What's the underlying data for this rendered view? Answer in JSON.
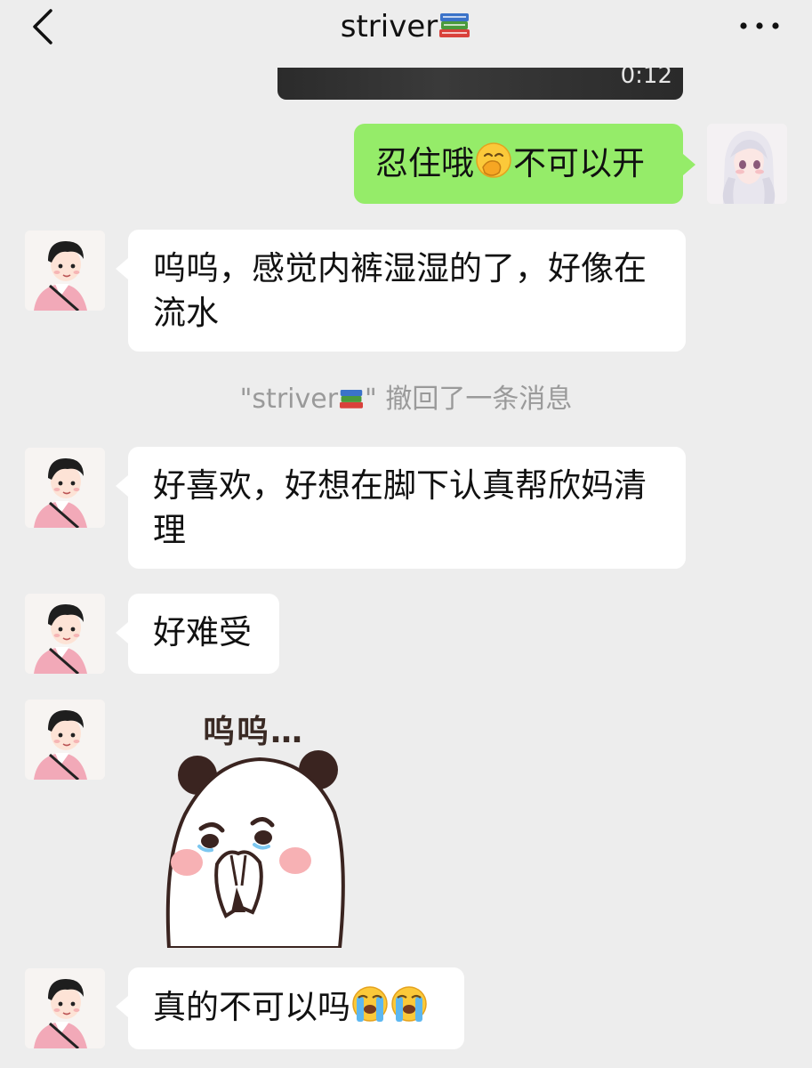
{
  "header": {
    "title": "striver",
    "title_icon": "books-emoji",
    "back_icon": "chevron-left-icon",
    "more_icon": "more-dots-icon"
  },
  "video": {
    "duration": "0:12"
  },
  "messages": [
    {
      "sender": "me",
      "text_before": "忍住哦",
      "emoji": "face-with-hand-over-mouth",
      "text_after": "不可以开"
    },
    {
      "sender": "striver",
      "text": "呜呜，感觉内裤湿湿的了，好像在流水"
    },
    {
      "sender": "system",
      "text_before": "\"striver",
      "icon": "books-emoji",
      "text_after": "\" 撤回了一条消息"
    },
    {
      "sender": "striver",
      "text": "好喜欢，好想在脚下认真帮欣妈清理"
    },
    {
      "sender": "striver",
      "text": "好难受"
    },
    {
      "sender": "striver",
      "sticker_text": "呜呜…"
    },
    {
      "sender": "striver",
      "text": "真的不可以吗",
      "emojis": [
        "loudly-crying-face",
        "loudly-crying-face"
      ]
    }
  ],
  "colors": {
    "background": "#ededed",
    "my_bubble": "#95ec69",
    "their_bubble": "#ffffff"
  }
}
